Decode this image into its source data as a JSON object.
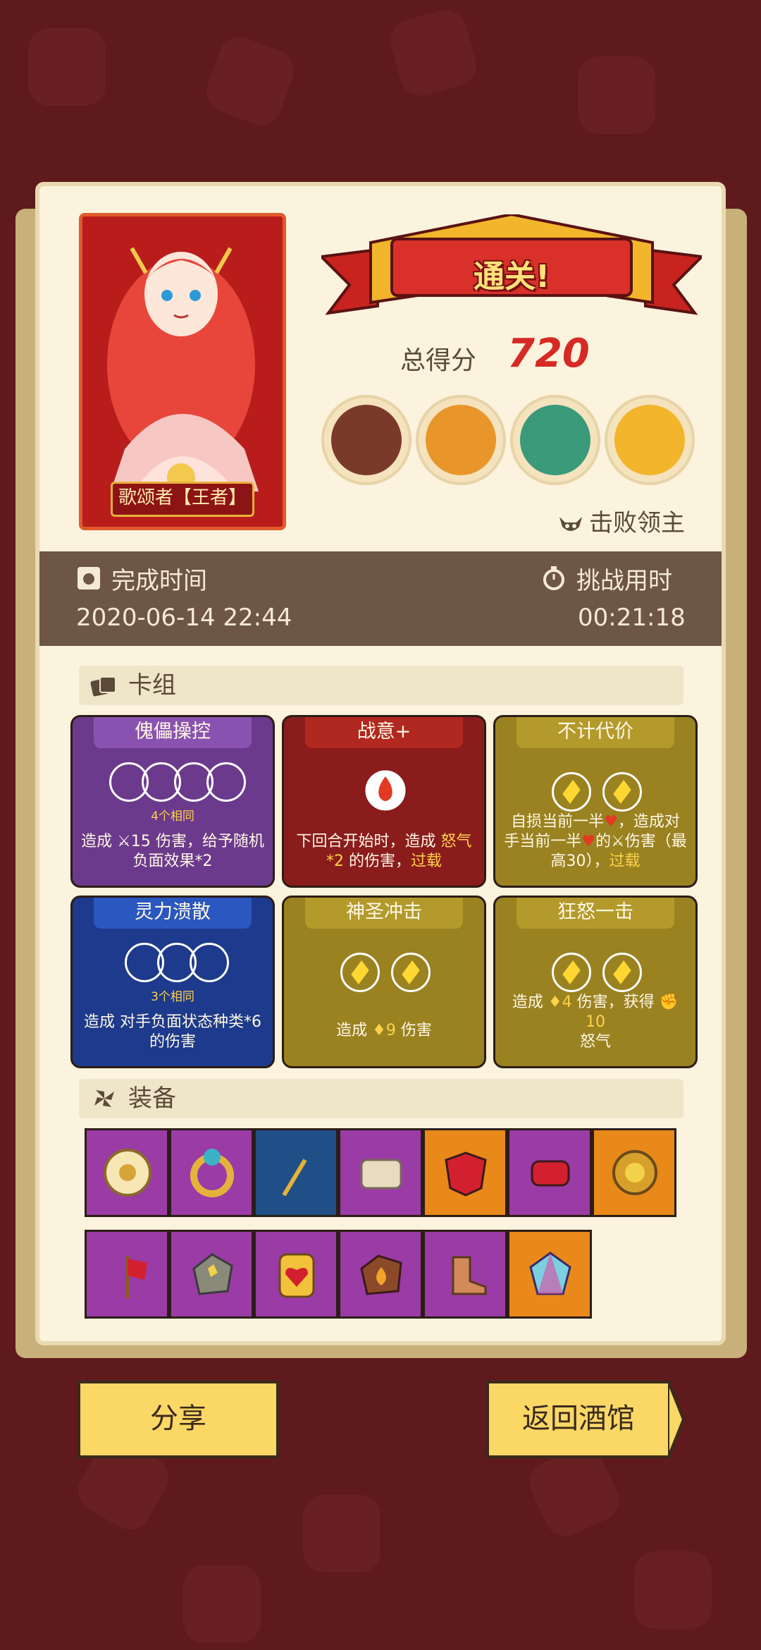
{
  "hero": {
    "name": "歌颂者【王者】"
  },
  "result": {
    "banner": "通关!",
    "score_label": "总得分",
    "score_value": "720",
    "defeat_label": "击败领主"
  },
  "time": {
    "finish_label": "完成时间",
    "finish_value": "2020-06-14 22:44",
    "duration_label": "挑战用时",
    "duration_value": "00:21:18"
  },
  "deck": {
    "title": "卡组",
    "cards": [
      {
        "name": "傀儡操控",
        "same": "4个相同",
        "desc_a": "造成 ",
        "desc_b": "15 伤害，给予随机负面效果*2",
        "color": "#6b3a8c"
      },
      {
        "name": "战意+",
        "desc_a": "下回合开始时，造成 ",
        "desc_hl": "怒气*2",
        "desc_b": " 的伤害，",
        "desc_hl2": "过载",
        "color": "#8a1c1c"
      },
      {
        "name": "不计代价",
        "desc_a": "自损当前一半",
        "desc_b": "，造成对手当前一半",
        "desc_c": "的",
        "desc_d": "伤害（最高30），",
        "desc_hl": "过载",
        "color": "#9a8221"
      },
      {
        "name": "灵力溃散",
        "same": "3个相同",
        "desc_a": "造成 对手负面状态种类*6的伤害",
        "color": "#1d3a8c"
      },
      {
        "name": "神圣冲击",
        "desc_a": "造成 ",
        "desc_hl": "9",
        "desc_b": " 伤害",
        "color": "#9a8221"
      },
      {
        "name": "狂怒一击",
        "desc_a": "造成 ",
        "desc_hl": "4",
        "desc_b": " 伤害，获得 ",
        "desc_hl2": "10",
        "desc_c": "怒气",
        "color": "#9a8221"
      }
    ]
  },
  "equipment": {
    "title": "装备",
    "items": [
      {
        "icon": "shield-icon",
        "bg": "#9a3ba6"
      },
      {
        "icon": "ring-icon",
        "bg": "#9a3ba6"
      },
      {
        "icon": "moon-wand-icon",
        "bg": "#1f4f86"
      },
      {
        "icon": "scroll-icon",
        "bg": "#9a3ba6"
      },
      {
        "icon": "armor-icon",
        "bg": "#e8891a"
      },
      {
        "icon": "bracer-icon",
        "bg": "#9a3ba6"
      },
      {
        "icon": "medal-icon",
        "bg": "#e8891a"
      },
      {
        "icon": "axe-icon",
        "bg": "#9a3ba6"
      },
      {
        "icon": "stone-icon",
        "bg": "#9a3ba6"
      },
      {
        "icon": "heart-card-icon",
        "bg": "#9a3ba6"
      },
      {
        "icon": "fire-stone-icon",
        "bg": "#9a3ba6"
      },
      {
        "icon": "boots-icon",
        "bg": "#9a3ba6"
      },
      {
        "icon": "crystal-icon",
        "bg": "#e8891a"
      }
    ]
  },
  "buttons": {
    "share": "分享",
    "back": "返回酒馆"
  }
}
